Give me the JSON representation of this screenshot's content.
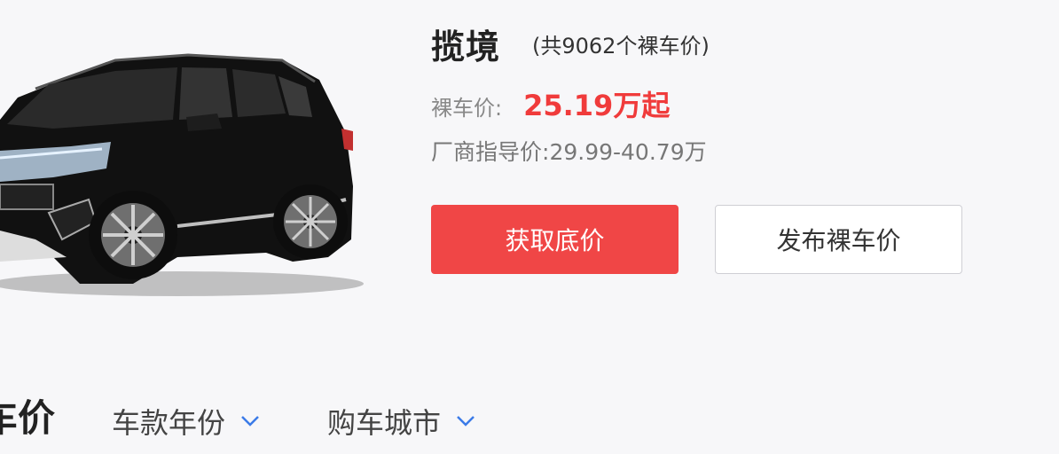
{
  "model": {
    "name": "揽境",
    "count_text": "(共9062个裸车价)"
  },
  "price": {
    "label": "裸车价:",
    "value": "25.19万起"
  },
  "guide_price": {
    "label": "厂商指导价:",
    "value": "29.99-40.79万"
  },
  "buttons": {
    "get_lowest": "获取底价",
    "publish": "发布裸车价"
  },
  "filters": {
    "section_title": "车价",
    "year_label": "车款年份",
    "city_label": "购车城市"
  },
  "colors": {
    "accent": "#f04646",
    "price_red": "#f03b3b",
    "chevron_blue": "#3b7be8"
  },
  "icons": {
    "dropdown": "chevron-down-icon"
  }
}
